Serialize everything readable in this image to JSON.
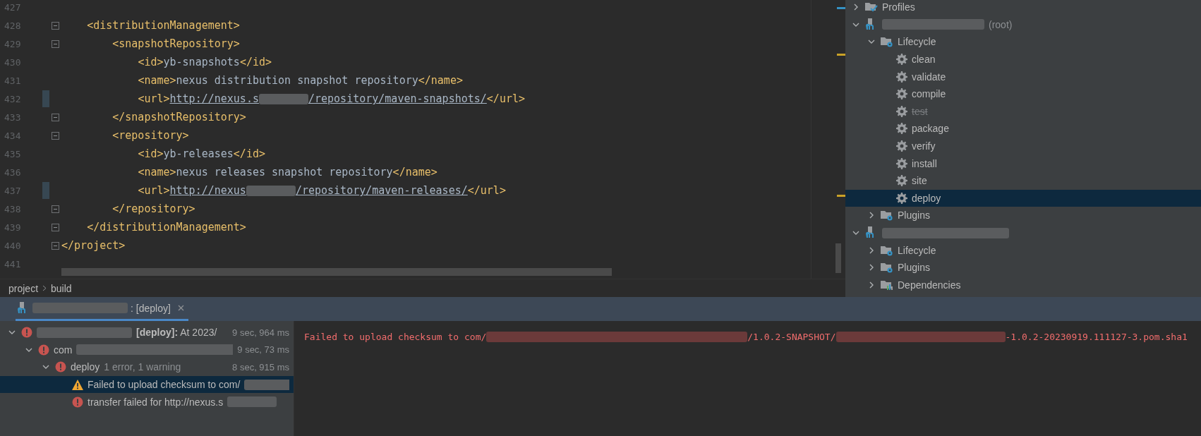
{
  "editor": {
    "lines": [
      {
        "number": "427",
        "fold": false,
        "changed": false
      },
      {
        "number": "428",
        "fold": true,
        "changed": false,
        "tokens": [
          {
            "kind": "tag",
            "text": "    <distributionManagement>"
          }
        ]
      },
      {
        "number": "429",
        "fold": true,
        "changed": false,
        "tokens": [
          {
            "kind": "tag",
            "text": "        <snapshotRepository>"
          }
        ]
      },
      {
        "number": "430",
        "fold": false,
        "changed": false,
        "tokens": [
          {
            "kind": "tag",
            "text": "            <id>"
          },
          {
            "kind": "value",
            "text": "yb-snapshots"
          },
          {
            "kind": "tag",
            "text": "</id>"
          }
        ]
      },
      {
        "number": "431",
        "fold": false,
        "changed": false,
        "tokens": [
          {
            "kind": "tag",
            "text": "            <name>"
          },
          {
            "kind": "value",
            "text": "nexus distribution snapshot repository"
          },
          {
            "kind": "tag",
            "text": "</name>"
          }
        ]
      },
      {
        "number": "432",
        "fold": false,
        "changed": true,
        "tokens": [
          {
            "kind": "tag",
            "text": "            <url>"
          },
          {
            "kind": "link",
            "text": "http://nexus.s"
          },
          {
            "kind": "redacted"
          },
          {
            "kind": "link",
            "text": "/repository/maven-snapshots/"
          },
          {
            "kind": "tag",
            "text": "</url>"
          }
        ]
      },
      {
        "number": "433",
        "fold": true,
        "changed": false,
        "tokens": [
          {
            "kind": "tag",
            "text": "        </snapshotRepository>"
          }
        ]
      },
      {
        "number": "434",
        "fold": true,
        "changed": false,
        "tokens": [
          {
            "kind": "tag",
            "text": "        <repository>"
          }
        ]
      },
      {
        "number": "435",
        "fold": false,
        "changed": false,
        "tokens": [
          {
            "kind": "tag",
            "text": "            <id>"
          },
          {
            "kind": "value",
            "text": "yb-releases"
          },
          {
            "kind": "tag",
            "text": "</id>"
          }
        ]
      },
      {
        "number": "436",
        "fold": false,
        "changed": false,
        "tokens": [
          {
            "kind": "tag",
            "text": "            <name>"
          },
          {
            "kind": "value",
            "text": "nexus releases snapshot repository"
          },
          {
            "kind": "tag",
            "text": "</name>"
          }
        ]
      },
      {
        "number": "437",
        "fold": false,
        "changed": true,
        "tokens": [
          {
            "kind": "tag",
            "text": "            <url>"
          },
          {
            "kind": "link",
            "text": "http://nexus"
          },
          {
            "kind": "redacted"
          },
          {
            "kind": "link",
            "text": "/repository/maven-releases/"
          },
          {
            "kind": "tag",
            "text": "</url>"
          }
        ]
      },
      {
        "number": "438",
        "fold": true,
        "changed": false,
        "tokens": [
          {
            "kind": "tag",
            "text": "        </repository>"
          }
        ]
      },
      {
        "number": "439",
        "fold": true,
        "changed": false,
        "tokens": [
          {
            "kind": "tag",
            "text": "    </distributionManagement>"
          }
        ]
      },
      {
        "number": "440",
        "fold": true,
        "changed": false,
        "tokens": [
          {
            "kind": "tag",
            "text": "</project>"
          }
        ]
      },
      {
        "number": "441",
        "fold": false,
        "changed": false
      }
    ]
  },
  "breadcrumbs": [
    "project",
    "build"
  ],
  "maven_panel": {
    "items": [
      {
        "kind": "profiles",
        "label": "Profiles",
        "expanded": false,
        "selected": false
      },
      {
        "kind": "module",
        "redacted": true,
        "label": "(root)",
        "expanded": true,
        "selected": false,
        "children": [
          {
            "kind": "folder",
            "label": "Lifecycle",
            "expanded": true,
            "selected": false,
            "children": [
              {
                "kind": "goal",
                "label": "clean",
                "disabled": false,
                "selected": false
              },
              {
                "kind": "goal",
                "label": "validate",
                "disabled": false,
                "selected": false
              },
              {
                "kind": "goal",
                "label": "compile",
                "disabled": false,
                "selected": false
              },
              {
                "kind": "goal",
                "label": "test",
                "disabled": true,
                "selected": false
              },
              {
                "kind": "goal",
                "label": "package",
                "disabled": false,
                "selected": false
              },
              {
                "kind": "goal",
                "label": "verify",
                "disabled": false,
                "selected": false
              },
              {
                "kind": "goal",
                "label": "install",
                "disabled": false,
                "selected": false
              },
              {
                "kind": "goal",
                "label": "site",
                "disabled": false,
                "selected": false
              },
              {
                "kind": "goal",
                "label": "deploy",
                "disabled": false,
                "selected": true
              }
            ]
          },
          {
            "kind": "folder",
            "label": "Plugins",
            "expanded": false,
            "selected": false
          }
        ]
      },
      {
        "kind": "module",
        "redacted": true,
        "expanded": true,
        "selected": false,
        "children": [
          {
            "kind": "folder",
            "label": "Lifecycle",
            "expanded": false,
            "selected": false
          },
          {
            "kind": "folder",
            "label": "Plugins",
            "expanded": false,
            "selected": false
          },
          {
            "kind": "dependencies",
            "label": "Dependencies",
            "expanded": false,
            "selected": false
          }
        ]
      }
    ]
  },
  "build_window": {
    "tab": {
      "redacted": true,
      "label": ": [deploy]",
      "selected": true
    },
    "tree": [
      {
        "kind": "error",
        "expanded": true,
        "selected": false,
        "redacted": true,
        "label": "**[deploy]:** At 2023/",
        "time": "9 sec, 964 ms",
        "children": [
          {
            "kind": "error",
            "expanded": true,
            "selected": false,
            "label": "com",
            "redacted": true,
            "time": "9 sec, 73 ms",
            "children": [
              {
                "kind": "error",
                "expanded": true,
                "selected": false,
                "label": "deploy",
                "detail": "1 error, 1 warning",
                "time": "8 sec, 915 ms",
                "children": [
                  {
                    "kind": "warning",
                    "selected": true,
                    "label": "Failed to upload checksum to com/",
                    "redacted": true
                  },
                  {
                    "kind": "error",
                    "selected": false,
                    "label": "transfer failed for http://nexus.s",
                    "redacted": true
                  }
                ]
              }
            ]
          }
        ]
      }
    ],
    "console": [
      {
        "kind": "text",
        "text": "Failed to upload checksum to com/"
      },
      {
        "kind": "redacted"
      },
      {
        "kind": "text",
        "text": "/1.0.2-SNAPSHOT/"
      },
      {
        "kind": "redacted"
      },
      {
        "kind": "text",
        "text": "-1.0.2-20230919.111127-3.pom.sha1"
      }
    ]
  }
}
